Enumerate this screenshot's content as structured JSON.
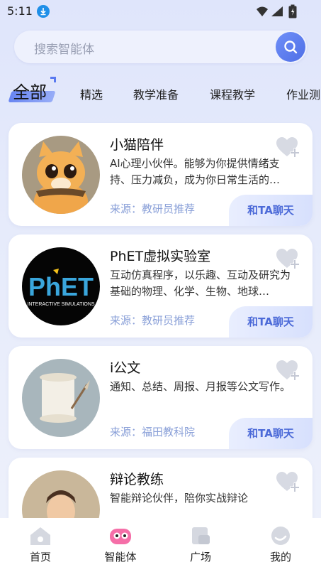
{
  "status_bar": {
    "time": "5:11"
  },
  "search": {
    "placeholder": "搜索智能体"
  },
  "tabs": {
    "active": "全部",
    "items": [
      "精选",
      "教学准备",
      "课程教学",
      "作业测"
    ]
  },
  "cards": [
    {
      "title": "小猫陪伴",
      "desc": "AI心理小伙伴。能够为你提供情绪支持、压力减负，成为你日常生活的…",
      "source": "来源：教研员推荐",
      "action": "和TA聊天"
    },
    {
      "title": "PhET虚拟实验室",
      "desc": "互动仿真程序，以乐趣、互动及研究为基础的物理、化学、生物、地球…",
      "source": "来源：教研员推荐",
      "action": "和TA聊天",
      "logo_text": "PhET",
      "logo_subtext": "INTERACTIVE SIMULATIONS"
    },
    {
      "title": "i公文",
      "desc": "通知、总结、周报、月报等公文写作。",
      "source": "来源：福田教科院",
      "action": "和TA聊天"
    },
    {
      "title": "辩论教练",
      "desc": "智能辩论伙伴，陪你实战辩论"
    }
  ],
  "bottom_nav": [
    {
      "label": "首页",
      "icon": "home-icon"
    },
    {
      "label": "智能体",
      "icon": "agent-icon"
    },
    {
      "label": "广场",
      "icon": "square-icon"
    },
    {
      "label": "我的",
      "icon": "profile-icon"
    }
  ],
  "colors": {
    "accent": "#4f6fe6",
    "source_text": "#8aa0d8",
    "chat_text": "#4c6ad8"
  }
}
